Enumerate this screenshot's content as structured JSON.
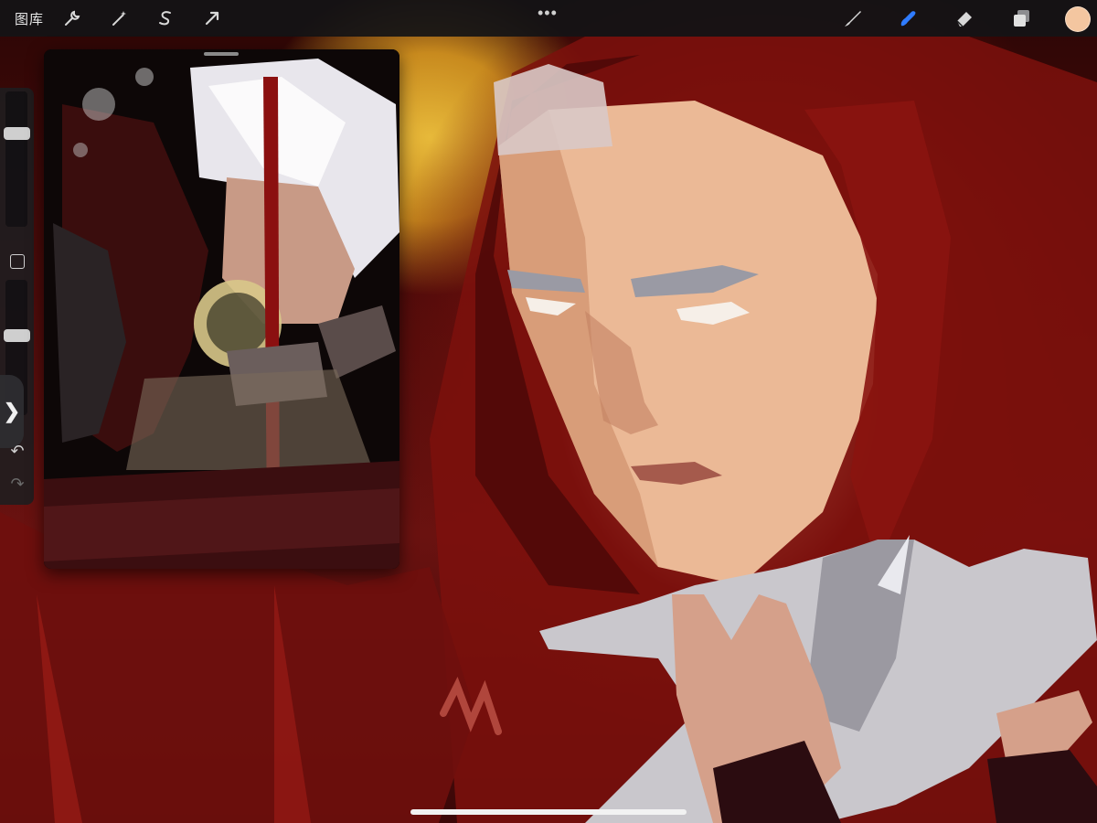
{
  "toolbar": {
    "gallery_label": "图库",
    "left_tools": [
      {
        "name": "actions",
        "icon": "wrench-icon"
      },
      {
        "name": "adjustments",
        "icon": "magic-wand-icon"
      },
      {
        "name": "selection",
        "icon": "selection-s-icon"
      },
      {
        "name": "transform",
        "icon": "arrow-cursor-icon"
      }
    ],
    "more_label": "•••",
    "right_tools": [
      {
        "name": "brush",
        "icon": "brush-icon",
        "active": false
      },
      {
        "name": "smudge",
        "icon": "smudge-finger-icon",
        "active": true
      },
      {
        "name": "eraser",
        "icon": "eraser-icon",
        "active": false
      },
      {
        "name": "layers",
        "icon": "layers-icon",
        "active": false
      }
    ],
    "current_color": "#f4c6a0"
  },
  "sidebar": {
    "brush_size_level": 0.71,
    "opacity_level": 0.6,
    "expand_glyph": "❯",
    "undo_glyph": "↶",
    "redo_glyph": "↷"
  },
  "colors": {
    "accent_active": "#2f7bff",
    "icon_default": "#d8d8d8"
  }
}
